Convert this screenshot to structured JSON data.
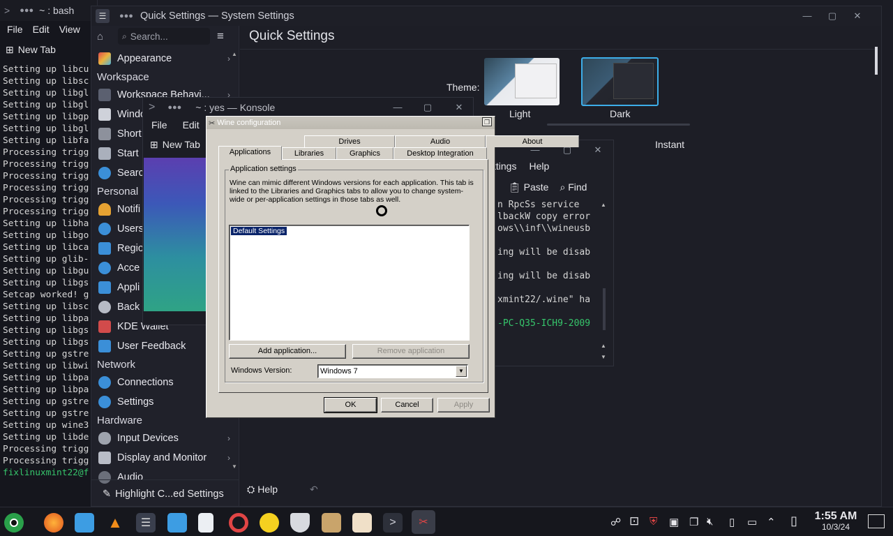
{
  "konsole_back": {
    "title": "~ : bash",
    "menu": [
      "File",
      "Edit",
      "View"
    ],
    "new_tab": "New Tab",
    "lines": [
      "Setting up libcu",
      "Setting up libsc",
      "Setting up libgl",
      "Setting up libgl",
      "Setting up libgp",
      "Setting up libgl",
      "Setting up libfa",
      "Processing trigg",
      "Processing trigg",
      "Processing trigg",
      "Processing trigg",
      "Processing trigg",
      "Processing trigg",
      "Setting up libha",
      "Setting up libgo",
      "Setting up libca",
      "Setting up glib-",
      "Setting up libgu",
      "Setting up libgs",
      "Setcap worked! g",
      "Setting up libsc",
      "Setting up libpa",
      "Setting up libgs",
      "Setting up libgs",
      "Setting up gstre",
      "Setting up libwi",
      "Setting up libpa",
      "Setting up libpa",
      "Setting up gstre",
      "Setting up gstre",
      "Setting up wine3",
      "Setting up libde",
      "Processing trigg",
      "Processing trigg"
    ],
    "prompt": "fixlinuxmint22@f"
  },
  "settings": {
    "window_title": "Quick Settings — System Settings",
    "search_placeholder": "Search...",
    "page_title": "Quick Settings",
    "theme_label": "Theme:",
    "theme_light": "Light",
    "theme_dark": "Dark",
    "anim_label": "Instant",
    "sidebar": {
      "appearance": "Appearance",
      "workspace_head": "Workspace",
      "workspace_behavior": "Workspace Behavi...",
      "windows": "Windo",
      "shortcuts": "Short",
      "startup": "Start",
      "search": "Searc",
      "personal_head": "Personal",
      "notifications": "Notifi",
      "users": "Users",
      "region": "Regio",
      "accessibility": "Acce",
      "applications": "Appli",
      "backup": "Back",
      "kde_wallet": "KDE Wallet",
      "user_feedback": "User Feedback",
      "network_head": "Network",
      "connections": "Connections",
      "net_settings": "Settings",
      "hardware_head": "Hardware",
      "input_devices": "Input Devices",
      "display_monitor": "Display and Monitor",
      "audio": "Audio"
    },
    "highlight_button": "Highlight C...ed Settings",
    "help_button": "Help"
  },
  "konsole_mid": {
    "title": "~ : yes — Konsole",
    "menu": [
      "File",
      "Edit"
    ],
    "new_tab": "New Tab"
  },
  "konsole_right": {
    "menu": [
      "ttings",
      "Help"
    ],
    "paste": "Paste",
    "find": "Find",
    "lines": [
      "n RpcSs service",
      "lbackW copy error",
      "ows\\\\inf\\\\wineusb",
      "",
      "ing will be disab",
      "",
      "ing will be disab",
      "",
      "xmint22/.wine\" ha",
      "",
      "-PC-Q35-ICH9-2009"
    ]
  },
  "wine": {
    "title": "Wine configuration",
    "tabs_row1": [
      "Drives",
      "Audio",
      "About"
    ],
    "tabs_row2": [
      "Applications",
      "Libraries",
      "Graphics",
      "Desktop Integration"
    ],
    "group_label": "Application settings",
    "description": "Wine can mimic different Windows versions for each application. This tab is linked to the Libraries and Graphics tabs to allow you to change system-wide or per-application settings in those tabs as well.",
    "list_items": [
      "Default Settings"
    ],
    "add_button": "Add application...",
    "remove_button": "Remove application",
    "version_label": "Windows Version:",
    "version_value": "Windows 7",
    "ok": "OK",
    "cancel": "Cancel",
    "apply": "Apply"
  },
  "taskbar": {
    "time": "1:55 AM",
    "date": "10/3/24"
  }
}
